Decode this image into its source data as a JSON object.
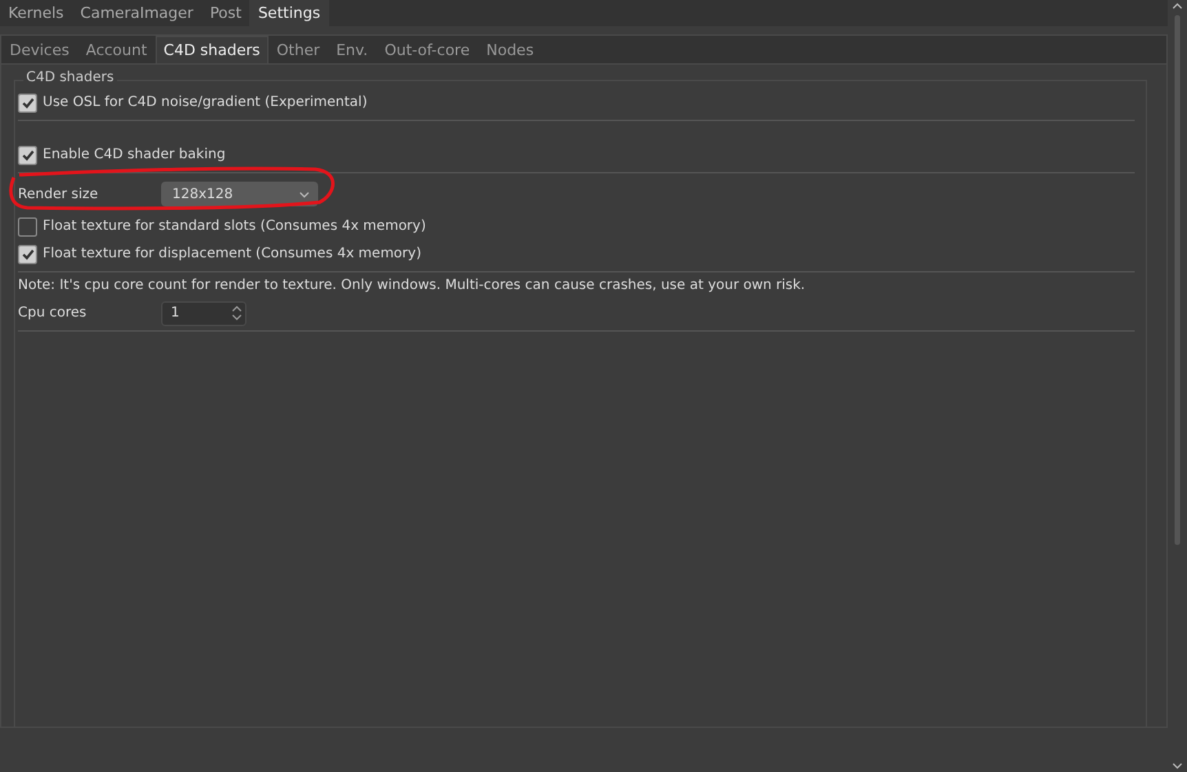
{
  "top_tabs": [
    {
      "label": "Kernels",
      "selected": false
    },
    {
      "label": "CameraImager",
      "selected": false
    },
    {
      "label": "Post",
      "selected": false
    },
    {
      "label": "Settings",
      "selected": true
    }
  ],
  "sub_tabs": [
    {
      "label": "Devices",
      "selected": false
    },
    {
      "label": "Account",
      "selected": false
    },
    {
      "label": "C4D shaders",
      "selected": true
    },
    {
      "label": "Other",
      "selected": false
    },
    {
      "label": "Env.",
      "selected": false
    },
    {
      "label": "Out-of-core",
      "selected": false
    },
    {
      "label": "Nodes",
      "selected": false
    }
  ],
  "group": {
    "title": "C4D shaders",
    "sections": [
      [
        {
          "kind": "checkbox",
          "label": "Use OSL for C4D noise/gradient (Experimental)",
          "checked": true
        }
      ],
      [
        {
          "kind": "checkbox",
          "label": "Enable C4D shader baking",
          "checked": true
        }
      ],
      [
        {
          "kind": "dropdown",
          "label": "Render size",
          "value": "128x128"
        },
        {
          "kind": "checkbox",
          "label": "Float texture for standard slots (Consumes 4x memory)",
          "checked": false
        },
        {
          "kind": "checkbox",
          "label": "Float texture for displacement (Consumes 4x memory)",
          "checked": true
        }
      ],
      [
        {
          "kind": "note",
          "label": "Note: It's cpu core count for render to texture. Only windows. Multi-cores can cause crashes, use at your own risk."
        },
        {
          "kind": "spinbox",
          "label": "Cpu cores",
          "value": "1"
        }
      ]
    ]
  }
}
